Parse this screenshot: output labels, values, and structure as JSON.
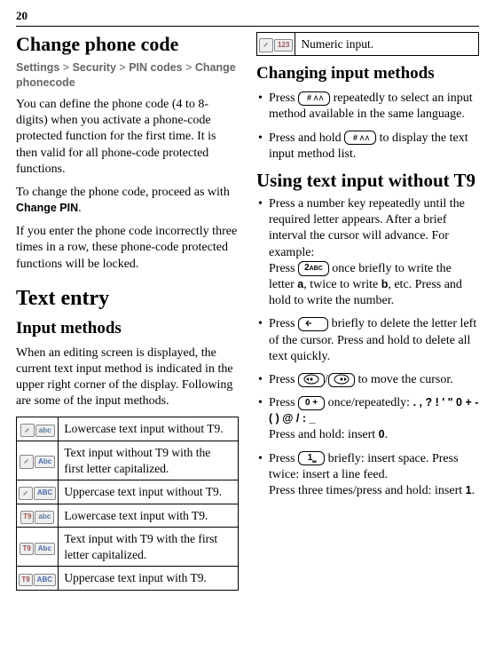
{
  "pageNumber": "20",
  "left": {
    "h1": "Change phone code",
    "path": {
      "s1": "Settings",
      "s2": "Security",
      "s3": "PIN codes",
      "s4": "Change phonecode"
    },
    "p1": "You can define the phone code (4 to 8-digits) when you activate a phone-code protected function for the first time. It is then valid for all phone-code protected functions.",
    "p2a": "To change the phone code, proceed as with ",
    "p2b": "Change PIN",
    "p2c": ".",
    "p3": "If you enter the phone code incorrectly three times in a row, these phone-code protected functions will be locked.",
    "h2": "Text entry",
    "h3": "Input methods",
    "p4": "When an editing screen is displayed, the current text input method is indicated in the upper right corner of the display. Following are some of the input methods.",
    "table": [
      {
        "icon": "abc-lower",
        "desc": "Lowercase text input without T9."
      },
      {
        "icon": "Abc-cap",
        "desc": "Text input without T9 with the first letter capitalized."
      },
      {
        "icon": "ABC-upper",
        "desc": "Uppercase text input without T9."
      },
      {
        "icon": "t9-abc-lower",
        "desc": "Lowercase text input with T9."
      },
      {
        "icon": "t9-Abc-cap",
        "desc": "Text input with T9 with the first letter capitalized."
      },
      {
        "icon": "t9-ABC-upper",
        "desc": "Uppercase text input with T9."
      }
    ]
  },
  "right": {
    "numTable": {
      "icon": "123",
      "desc": "Numeric input."
    },
    "h1": "Changing input methods",
    "b1a": "Press ",
    "b1key": "hash",
    "b1b": " repeatedly to select an input method available in the same language.",
    "b2a": "Press and hold ",
    "b2key": "hash",
    "b2b": " to display the text input method list.",
    "h2": "Using text input without T9",
    "b3a": "Press a number key repeatedly until the required letter appears. After a brief interval the cursor will advance. For example:",
    "b3b": "Press ",
    "b3key": "2ABC",
    "b3c": " once briefly to write the letter ",
    "b3d": "a",
    "b3e": ", twice to write ",
    "b3f": "b",
    "b3g": ", etc. Press and hold to write the number.",
    "b4a": "Press ",
    "b4key": "back",
    "b4b": " briefly to delete the letter left of the cursor. Press and hold to delete all text quickly.",
    "b5a": "Press ",
    "b5key1": "left",
    "b5sep": "/",
    "b5key2": "right",
    "b5b": " to move the cursor.",
    "b6a": "Press ",
    "b6key": "0+",
    "b6b": " once/repeatedly:",
    "b6chars": ". , ? ! ' \" 0 + - ( ) @ / : _",
    "b6c": "Press and hold: insert ",
    "b6d": "0",
    "b6e": ".",
    "b7a": "Press ",
    "b7key": "1space",
    "b7b": " briefly: insert space. Press twice: insert a line feed.",
    "b7c": "Press three times/press and hold: insert ",
    "b7d": "1",
    "b7e": "."
  }
}
